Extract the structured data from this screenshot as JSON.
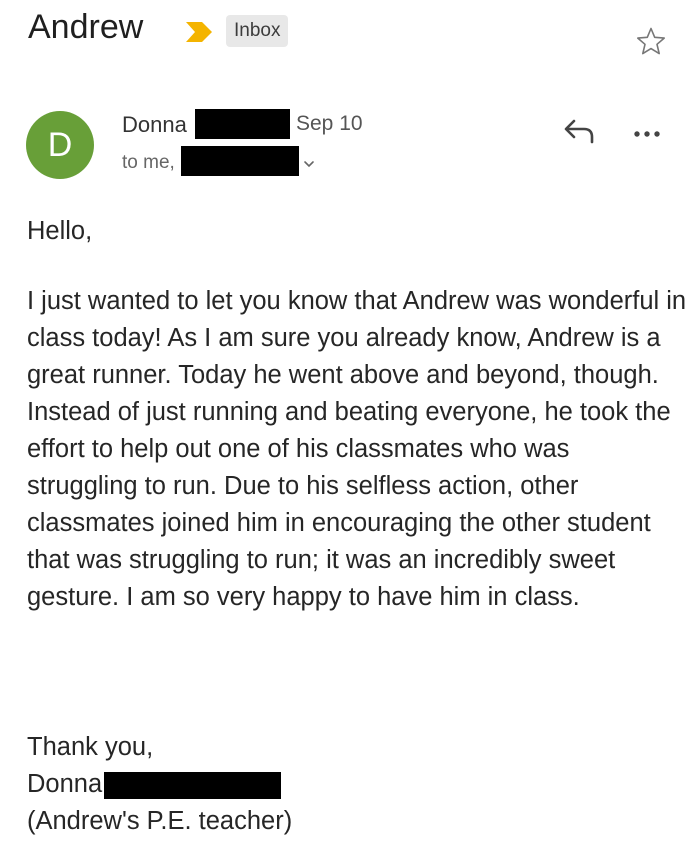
{
  "header": {
    "subject": "Andrew",
    "label": "Inbox",
    "important_icon": "important-marker-icon",
    "star_icon": "star-outline-icon"
  },
  "message": {
    "avatar_letter": "D",
    "avatar_color": "#689f38",
    "sender_name": "Donna",
    "date": "Sep 10",
    "recipients_prefix": "to me,",
    "reply_icon": "reply-icon",
    "more_icon": "more-options-icon",
    "greeting": "Hello,",
    "paragraph": "I just wanted to let you know that Andrew was wonderful in class today! As I am sure you already know, Andrew is a great runner. Today he went above and beyond, though. Instead of just running and beating everyone, he took the effort to help out one of his classmates who was struggling to run. Due to his selfless action, other classmates joined him in encouraging the other student that was struggling to run; it was an incredibly sweet gesture. I am so very happy to have him in class.",
    "signoff_line": "Thank you,",
    "signature_name": "Donna",
    "signature_role": "(Andrew's P.E. teacher)"
  },
  "colors": {
    "important_marker": "#f4b400",
    "label_background": "#e8e8e8",
    "redaction": "#000000"
  }
}
